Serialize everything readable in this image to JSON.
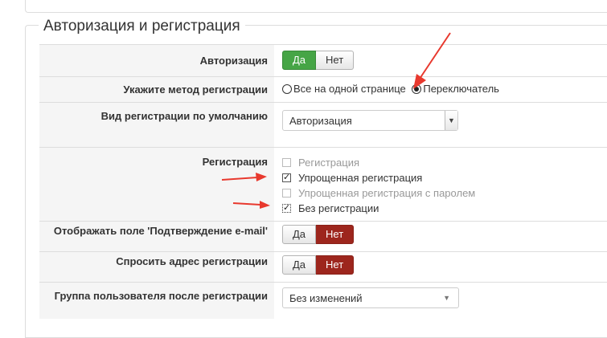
{
  "legend": "Авторизация и регистрация",
  "rows": {
    "auth": {
      "label": "Авторизация",
      "yes": "Да",
      "no": "Нет"
    },
    "method": {
      "label": "Укажите метод регистрации",
      "option1": "Все на одной странице",
      "option2": "Переключатель"
    },
    "default_view": {
      "label": "Вид регистрации по умолчанию",
      "value": "Авторизация"
    },
    "registration": {
      "label": "Регистрация",
      "items": [
        {
          "label": "Регистрация",
          "checked": false,
          "disabled": true
        },
        {
          "label": "Упрощенная регистрация",
          "checked": true,
          "disabled": false
        },
        {
          "label": "Упрощенная регистрация с паролем",
          "checked": false,
          "disabled": true
        },
        {
          "label": "Без регистрации",
          "checked": true,
          "disabled": false
        }
      ]
    },
    "confirm_email": {
      "label": "Отображать поле 'Подтверждение e-mail'",
      "yes": "Да",
      "no": "Нет"
    },
    "ask_address": {
      "label": "Спросить адрес регистрации",
      "yes": "Да",
      "no": "Нет"
    },
    "user_group": {
      "label": "Группа пользователя после регистрации",
      "value": "Без изменений"
    }
  },
  "colors": {
    "green": "#46a546",
    "red": "#9d261d",
    "arrow": "#e8392e"
  }
}
